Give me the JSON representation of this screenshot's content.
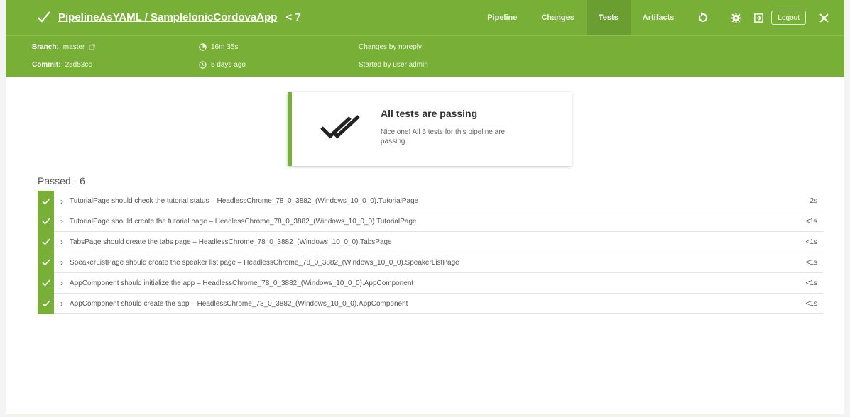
{
  "header": {
    "title": "PipelineAsYAML / SampleIonicCordovaApp",
    "run_number": "< 7",
    "tabs": [
      {
        "label": "Pipeline",
        "active": false
      },
      {
        "label": "Changes",
        "active": false
      },
      {
        "label": "Tests",
        "active": true
      },
      {
        "label": "Artifacts",
        "active": false
      }
    ],
    "logout_label": "Logout",
    "icons": [
      "replay-icon",
      "gear-icon",
      "exit-icon",
      "close-icon"
    ]
  },
  "run_meta": {
    "branch_label": "Branch:",
    "branch_value": "master",
    "commit_label": "Commit:",
    "commit_value": "25d53cc",
    "duration": "16m 35s",
    "finished": "5 days ago",
    "changes": "Changes by noreply",
    "started_by": "Started by user admin"
  },
  "summary": {
    "title": "All tests are passing",
    "description": "Nice one! All 6 tests for this pipeline are passing."
  },
  "passed": {
    "heading": "Passed - 6",
    "tests": [
      {
        "name": "TutorialPage should check the tutorial status – HeadlessChrome_78_0_3882_(Windows_10_0_0).TutorialPage",
        "time": "2s"
      },
      {
        "name": "TutorialPage should create the tutorial page – HeadlessChrome_78_0_3882_(Windows_10_0_0).TutorialPage",
        "time": "<1s"
      },
      {
        "name": "TabsPage should create the tabs page – HeadlessChrome_78_0_3882_(Windows_10_0_0).TabsPage",
        "time": "<1s"
      },
      {
        "name": "SpeakerListPage should create the speaker list page – HeadlessChrome_78_0_3882_(Windows_10_0_0).SpeakerListPage",
        "time": "<1s"
      },
      {
        "name": "AppComponent should initialize the app – HeadlessChrome_78_0_3882_(Windows_10_0_0).AppComponent",
        "time": "<1s"
      },
      {
        "name": "AppComponent should create the app – HeadlessChrome_78_0_3882_(Windows_10_0_0).AppComponent",
        "time": "<1s"
      }
    ]
  },
  "colors": {
    "header_green": "#78b037",
    "active_tab": "#6a9e30",
    "status_pass": "#78b037"
  }
}
